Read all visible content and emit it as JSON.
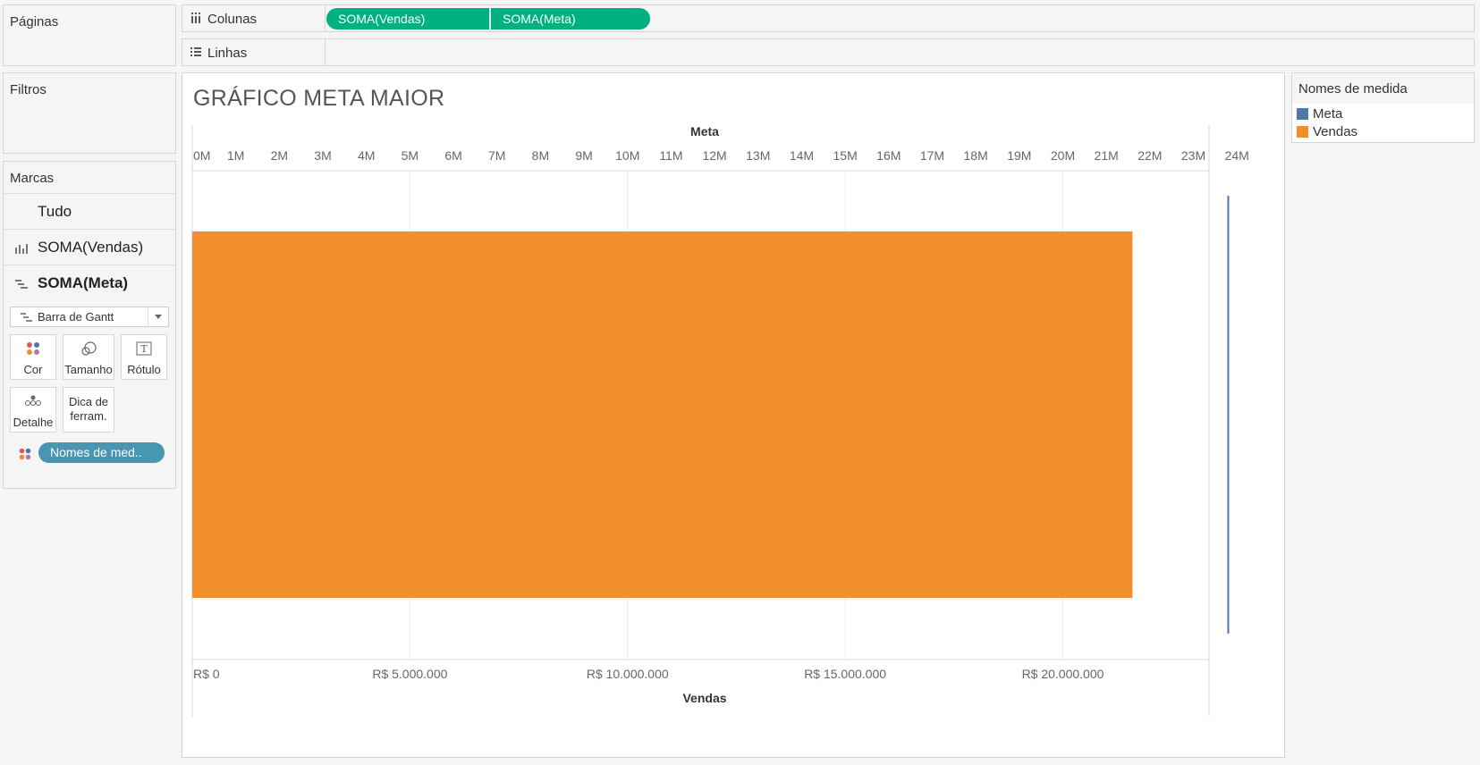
{
  "left_panel": {
    "pages_title": "Páginas",
    "filters_title": "Filtros",
    "marks_title": "Marcas",
    "marks_rows": [
      {
        "label": "Tudo"
      },
      {
        "label": "SOMA(Vendas)"
      },
      {
        "label": "SOMA(Meta)"
      }
    ],
    "mark_type": "Barra de Gantt",
    "buttons": {
      "color": "Cor",
      "size": "Tamanho",
      "label": "Rótulo",
      "detail": "Detalhe",
      "tooltip_line1": "Dica de",
      "tooltip_line2": "ferram."
    },
    "color_pill": "Nomes de med.."
  },
  "shelves": {
    "columns_label": "Colunas",
    "columns_pills": [
      "SOMA(Vendas)",
      "SOMA(Meta)"
    ],
    "rows_label": "Linhas"
  },
  "sheet": {
    "title": "GRÁFICO META MAIOR"
  },
  "legend": {
    "title": "Nomes de medida",
    "items": [
      {
        "label": "Meta",
        "color": "#4e79a7"
      },
      {
        "label": "Vendas",
        "color": "#f28e2b"
      }
    ]
  },
  "colors": {
    "pill_green": "#00b180",
    "pill_teal": "#4996b2",
    "vendas": "#f28e2b",
    "meta": "#4e79a7"
  },
  "chart_data": {
    "type": "bar",
    "orientation": "horizontal",
    "series": [
      {
        "name": "Vendas",
        "values": [
          21600000
        ],
        "mark": "bar",
        "axis": "bottom",
        "color": "#f28e2b"
      },
      {
        "name": "Meta",
        "values": [
          23800000
        ],
        "mark": "gantt-line",
        "axis": "top",
        "color": "#4e79a7"
      }
    ],
    "top_axis": {
      "title": "Meta",
      "range": [
        0,
        24900000
      ],
      "ticks": [
        0,
        1,
        2,
        3,
        4,
        5,
        6,
        7,
        8,
        9,
        10,
        11,
        12,
        13,
        14,
        15,
        16,
        17,
        18,
        19,
        20,
        21,
        22,
        23,
        24
      ],
      "tick_labels": [
        "0M",
        "1M",
        "2M",
        "3M",
        "4M",
        "5M",
        "6M",
        "7M",
        "8M",
        "9M",
        "10M",
        "11M",
        "12M",
        "13M",
        "14M",
        "15M",
        "16M",
        "17M",
        "18M",
        "19M",
        "20M",
        "21M",
        "22M",
        "23M",
        "24M"
      ]
    },
    "bottom_axis": {
      "title": "Vendas",
      "range": [
        0,
        24900000
      ],
      "ticks": [
        0,
        5000000,
        10000000,
        15000000,
        20000000
      ],
      "tick_labels": [
        "R$ 0",
        "R$ 5.000.000",
        "R$ 10.000.000",
        "R$ 15.000.000",
        "R$ 20.000.000"
      ]
    },
    "grid": true
  }
}
